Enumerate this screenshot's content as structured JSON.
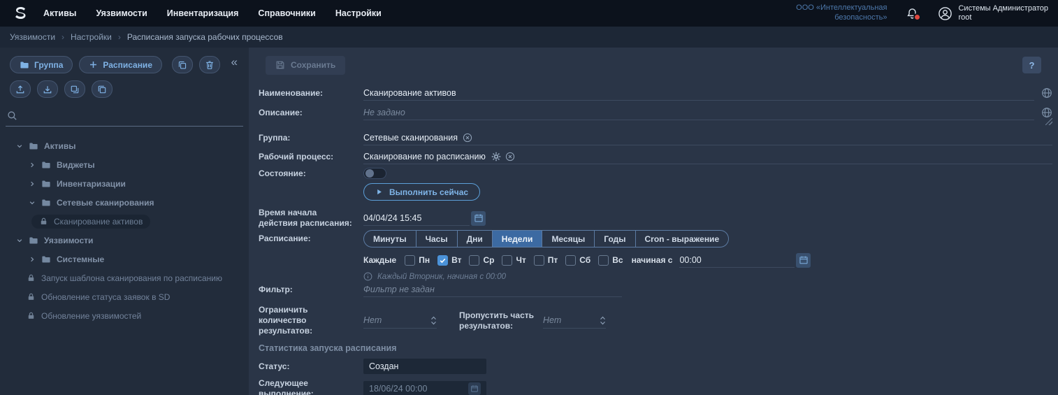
{
  "topbar": {
    "menu": [
      "Активы",
      "Уязвимости",
      "Инвентаризация",
      "Справочники",
      "Настройки"
    ],
    "org_line1": "ООО «Интеллектуальная",
    "org_line2": "безопасность»",
    "user_name": "Системы Администратор",
    "user_role": "root"
  },
  "breadcrumb": [
    "Уязвимости",
    "Настройки",
    "Расписания запуска рабочих процессов"
  ],
  "sidebar": {
    "group_button": "Группа",
    "schedule_button": "Расписание",
    "collapse_glyph": "«",
    "tree": [
      {
        "label": "Активы",
        "level": 0,
        "type": "folder",
        "expanded": true
      },
      {
        "label": "Виджеты",
        "level": 1,
        "type": "folder",
        "expanded": false
      },
      {
        "label": "Инвентаризации",
        "level": 1,
        "type": "folder",
        "expanded": false
      },
      {
        "label": "Сетевые сканирования",
        "level": 1,
        "type": "folder",
        "expanded": true
      },
      {
        "label": "Сканирование активов",
        "level": 2,
        "type": "lock",
        "selected": true
      },
      {
        "label": "Уязвимости",
        "level": 0,
        "type": "folder",
        "expanded": true
      },
      {
        "label": "Системные",
        "level": 1,
        "type": "folder",
        "expanded": false
      },
      {
        "label": "Запуск шаблона сканирования по расписанию",
        "level": 1,
        "type": "lock",
        "selected": false
      },
      {
        "label": "Обновление статуса заявок в SD",
        "level": 1,
        "type": "lock",
        "selected": false
      },
      {
        "label": "Обновление уязвимостей",
        "level": 1,
        "type": "lock",
        "selected": false
      }
    ]
  },
  "main": {
    "save_label": "Сохранить",
    "help_label": "?",
    "form": {
      "name": {
        "label": "Наименование:",
        "value": "Сканирование активов"
      },
      "description": {
        "label": "Описание:",
        "placeholder": "Не задано"
      },
      "group": {
        "label": "Группа:",
        "value": "Сетевые сканирования"
      },
      "workflow": {
        "label": "Рабочий процесс:",
        "value": "Сканирование по расписанию"
      },
      "state": {
        "label": "Состояние:",
        "enabled": false
      },
      "run_now_label": "Выполнить сейчас",
      "start_time": {
        "label": "Время начала действия расписания:",
        "value": "04/04/24 15:45"
      },
      "schedule": {
        "label": "Расписание:",
        "tabs": [
          "Минуты",
          "Часы",
          "Дни",
          "Недели",
          "Месяцы",
          "Годы",
          "Cron - выражение"
        ],
        "active_tab": "Недели",
        "every_label": "Каждые",
        "days": [
          {
            "label": "Пн",
            "checked": false
          },
          {
            "label": "Вт",
            "checked": true
          },
          {
            "label": "Ср",
            "checked": false
          },
          {
            "label": "Чт",
            "checked": false
          },
          {
            "label": "Пт",
            "checked": false
          },
          {
            "label": "Сб",
            "checked": false
          },
          {
            "label": "Вс",
            "checked": false
          }
        ],
        "starting_label": "начиная с",
        "start_clock": "00:00",
        "hint": "Каждый Вторник, начиная с 00:00"
      },
      "filter": {
        "label": "Фильтр:",
        "placeholder": "Фильтр не задан"
      },
      "limit": {
        "label": "Ограничить количество результатов:",
        "placeholder": "Нет"
      },
      "skip": {
        "label": "Пропустить часть результатов:",
        "placeholder": "Нет"
      }
    },
    "stats": {
      "title": "Статистика запуска расписания",
      "status": {
        "label": "Статус:",
        "value": "Создан"
      },
      "next_run": {
        "label": "Следующее выполнение:",
        "value": "18/06/24 00:00"
      }
    }
  }
}
